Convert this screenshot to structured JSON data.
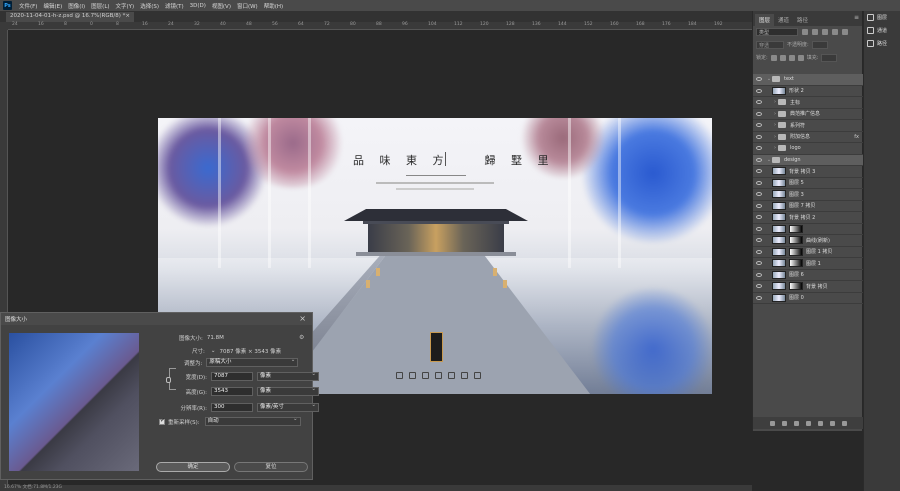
{
  "app": {
    "logo": "Ps"
  },
  "menu": [
    "文件(F)",
    "编辑(E)",
    "图像(I)",
    "图层(L)",
    "文字(Y)",
    "选择(S)",
    "滤镜(T)",
    "3D(D)",
    "视图(V)",
    "窗口(W)",
    "帮助(H)"
  ],
  "document_tab": {
    "title": "2020-11-04-01-h-z.psd @ 16.7%(RGB/8) *",
    "close": "×"
  },
  "ruler": {
    "marks": [
      "24",
      "16",
      "8",
      "0",
      "8",
      "16",
      "24",
      "32",
      "40",
      "48",
      "56",
      "64",
      "72",
      "80",
      "88",
      "96",
      "104",
      "112",
      "120",
      "128",
      "136",
      "144",
      "152",
      "160",
      "168",
      "176",
      "184",
      "192"
    ]
  },
  "artwork": {
    "title_left": "品 味 東 方",
    "title_right": "歸 墅 里"
  },
  "layers_panel": {
    "tabs": [
      "图层",
      "通道",
      "路径"
    ],
    "active_tab": "图层",
    "filter_label": "类型",
    "mode_value": "穿透",
    "opacity_label": "不透明度:",
    "lock_label": "锁定:",
    "fill_label": "填充:",
    "layers": [
      {
        "name": "text",
        "type": "group",
        "expanded": true,
        "selected": true,
        "indent": 0
      },
      {
        "name": "形状 2",
        "type": "shape",
        "indent": 1
      },
      {
        "name": "主标",
        "type": "group",
        "indent": 1
      },
      {
        "name": "典范推广信息",
        "type": "group",
        "indent": 1
      },
      {
        "name": "系列符",
        "type": "group",
        "indent": 1
      },
      {
        "name": "附加信息",
        "type": "group",
        "indent": 1,
        "fx": "fx"
      },
      {
        "name": "logo",
        "type": "group",
        "indent": 1
      },
      {
        "name": "design",
        "type": "group",
        "expanded": true,
        "selected": true,
        "indent": 0
      },
      {
        "name": "背景 拷贝 3",
        "type": "layer",
        "indent": 1
      },
      {
        "name": "图层 5",
        "type": "layer",
        "indent": 1
      },
      {
        "name": "图层 3",
        "type": "layer",
        "indent": 1
      },
      {
        "name": "图层 7 拷贝",
        "type": "layer",
        "indent": 1
      },
      {
        "name": "背景 拷贝 2",
        "type": "layer",
        "indent": 1
      },
      {
        "name": "",
        "type": "adjustment",
        "indent": 1
      },
      {
        "name": "曲线(刷新)",
        "type": "masked",
        "indent": 1
      },
      {
        "name": "图层 1 拷贝",
        "type": "masked",
        "indent": 1
      },
      {
        "name": "图层 1",
        "type": "masked",
        "indent": 1
      },
      {
        "name": "图层 6",
        "type": "layer",
        "indent": 1
      },
      {
        "name": "背景 拷贝",
        "type": "masked",
        "indent": 1
      },
      {
        "name": "图层 0",
        "type": "layer",
        "indent": 1
      }
    ]
  },
  "side_panel": {
    "items": [
      "图层",
      "通道",
      "路径"
    ]
  },
  "dialog": {
    "title": "图像大小",
    "close": "×",
    "image_size_label": "图像大小:",
    "image_size_value": "71.8M",
    "dimensions_label": "尺寸:",
    "dimensions_value": "7087 像素 × 3543 像素",
    "fit_label": "调整为:",
    "fit_value": "原稿大小",
    "width_label": "宽度(D):",
    "width_value": "7087",
    "width_unit": "像素",
    "height_label": "高度(G):",
    "height_value": "3543",
    "height_unit": "像素",
    "resolution_label": "分辨率(R):",
    "resolution_value": "300",
    "resolution_unit": "像素/英寸",
    "resample_label": "重新采样(S):",
    "resample_value": "自动",
    "ok_label": "确定",
    "reset_label": "复位"
  },
  "statusbar": {
    "text": "16.67%   文档:71.8M/1.23G"
  }
}
